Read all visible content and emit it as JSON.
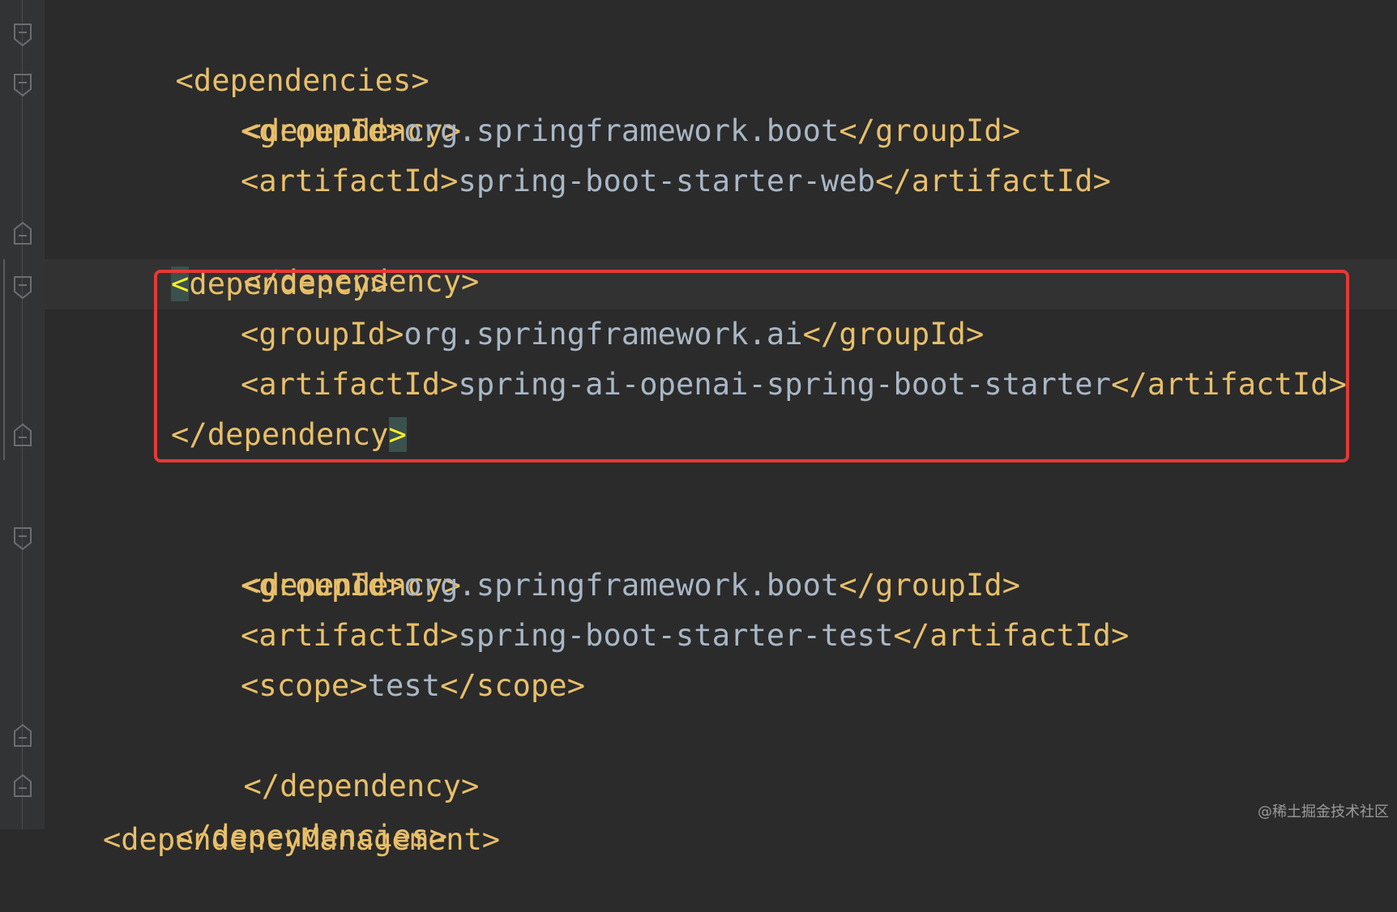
{
  "code": {
    "lines": [
      {
        "indent": 0,
        "tag_open": "<dependencies>"
      },
      {
        "indent": 1,
        "tag_open": "<dependency>"
      },
      {
        "indent": 2,
        "tag_open": "<groupId>",
        "text": "org.springframework.boot",
        "tag_close": "</groupId>"
      },
      {
        "indent": 2,
        "tag_open": "<artifactId>",
        "text": "spring-boot-starter-web",
        "tag_close": "</artifactId>"
      },
      {
        "indent": 1,
        "tag_open": "</dependency>"
      },
      {
        "indent": 1,
        "tag_open": "<dependency>"
      },
      {
        "indent": 2,
        "tag_open": "<groupId>",
        "text": "org.springframework.ai",
        "tag_close": "</groupId>"
      },
      {
        "indent": 2,
        "tag_open": "<artifactId>",
        "text": "spring-ai-openai-spring-boot-starter",
        "tag_close": "</artifactId>"
      },
      {
        "indent": 1,
        "tag_open": "</dependency>"
      },
      {
        "indent": 1,
        "tag_open": "<dependency>"
      },
      {
        "indent": 2,
        "tag_open": "<groupId>",
        "text": "org.springframework.boot",
        "tag_close": "</groupId>"
      },
      {
        "indent": 2,
        "tag_open": "<artifactId>",
        "text": "spring-boot-starter-test",
        "tag_close": "</artifactId>"
      },
      {
        "indent": 2,
        "tag_open": "<scope>",
        "text": "test",
        "tag_close": "</scope>"
      },
      {
        "indent": 1,
        "tag_open": "</dependency>"
      },
      {
        "indent": 0,
        "tag_open": "</dependencies>"
      }
    ],
    "partial_last_line": "<dependencyManagement>"
  },
  "colors": {
    "background": "#2b2b2b",
    "tag": "#e8bf6a",
    "text": "#a9b7c6",
    "highlight_box": "#e53935",
    "bracket_match": "#ffef28"
  },
  "watermark": "@稀土掘金技术社区"
}
